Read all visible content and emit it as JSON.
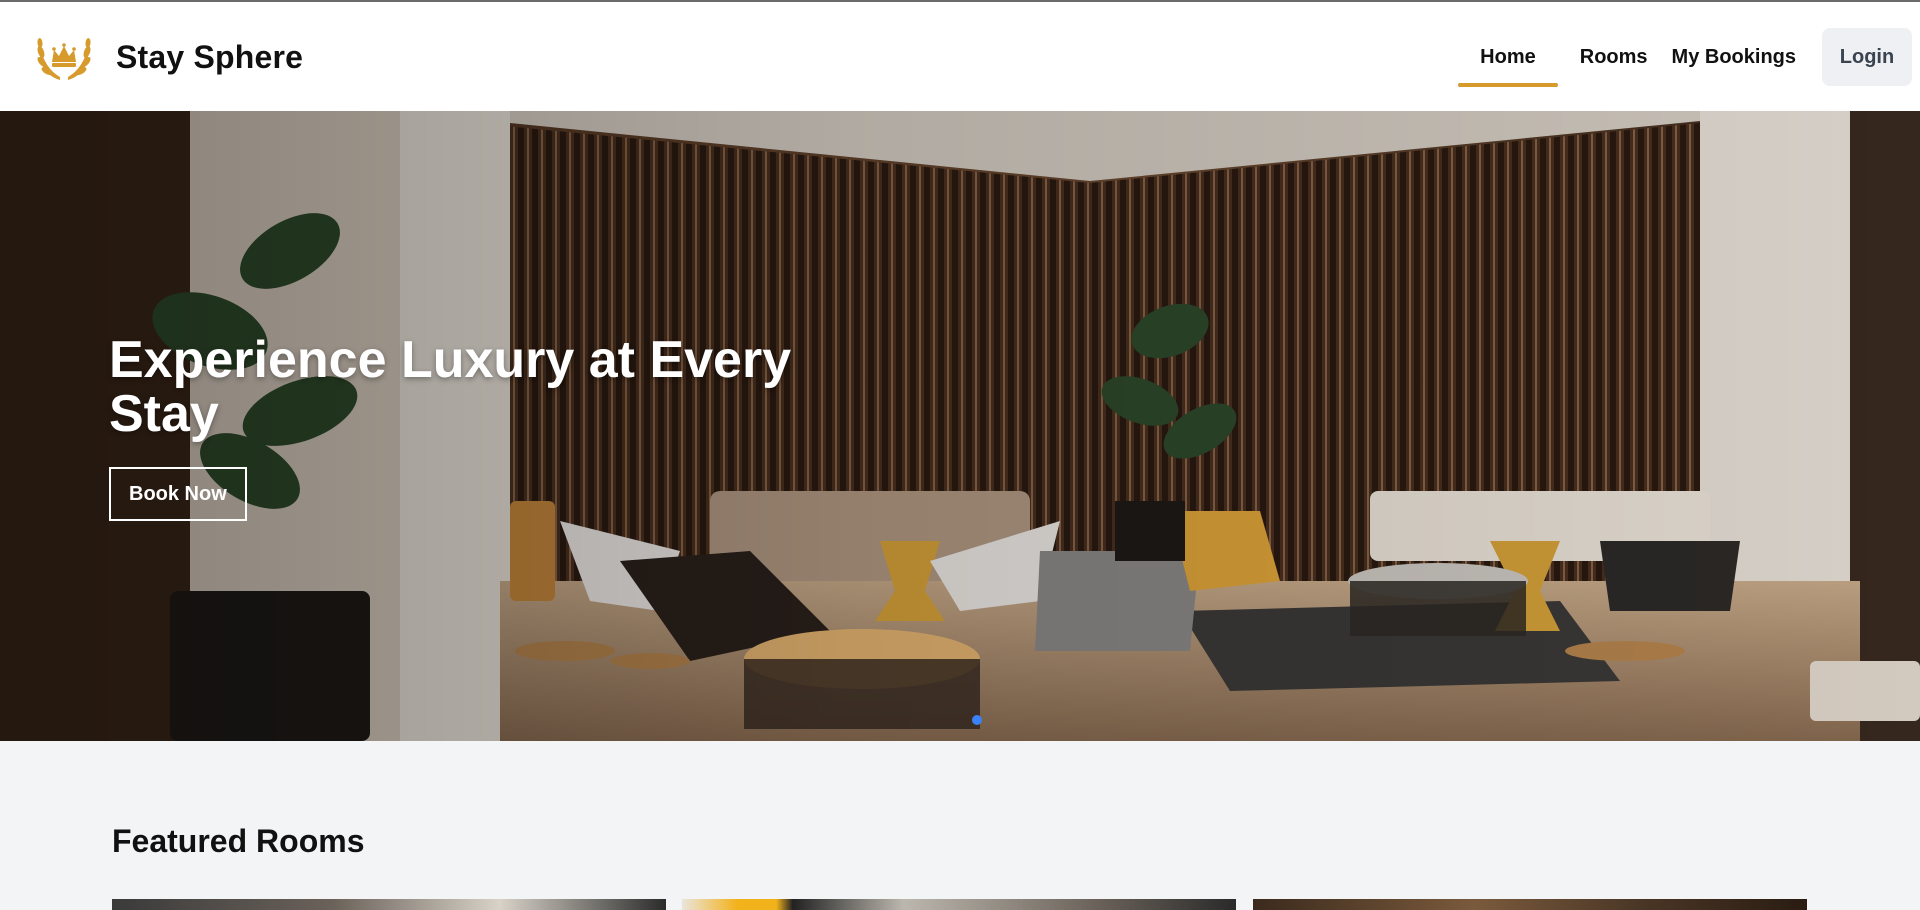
{
  "header": {
    "brand_name": "Stay Sphere",
    "logo_icon": "crown-laurel-icon",
    "nav": [
      {
        "label": "Home",
        "active": true
      },
      {
        "label": "Rooms",
        "active": false
      },
      {
        "label": "My Bookings",
        "active": false
      }
    ],
    "login_label": "Login"
  },
  "hero": {
    "title": "Experience Luxury at Every Stay",
    "cta_label": "Book Now",
    "slides_shown": 1
  },
  "featured": {
    "title": "Featured Rooms",
    "rooms_visible": 3
  },
  "colors": {
    "accent": "#d69a2d",
    "header_bg": "#ffffff",
    "page_bg": "#f3f4f6",
    "login_bg": "#eef0f3",
    "dot": "#3b82f6"
  }
}
